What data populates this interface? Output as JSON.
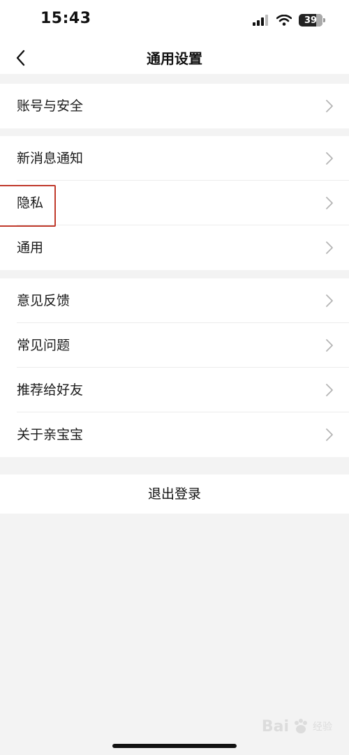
{
  "status_bar": {
    "time": "15:43",
    "battery": "39"
  },
  "nav": {
    "title": "通用设置"
  },
  "groups": [
    {
      "items": [
        {
          "label": "账号与安全"
        }
      ]
    },
    {
      "items": [
        {
          "label": "新消息通知"
        },
        {
          "label": "隐私"
        },
        {
          "label": "通用"
        }
      ]
    },
    {
      "items": [
        {
          "label": "意见反馈"
        },
        {
          "label": "常见问题"
        },
        {
          "label": "推荐给好友"
        },
        {
          "label": "关于亲宝宝"
        }
      ]
    }
  ],
  "logout": {
    "label": "退出登录"
  },
  "watermark": {
    "text": "Bai",
    "sub": "经验"
  },
  "icons": {
    "back": "back-chevron-icon",
    "row_arrow": "chevron-right-icon"
  },
  "colors": {
    "background": "#f3f3f3",
    "highlight_box": "#c0392b"
  }
}
